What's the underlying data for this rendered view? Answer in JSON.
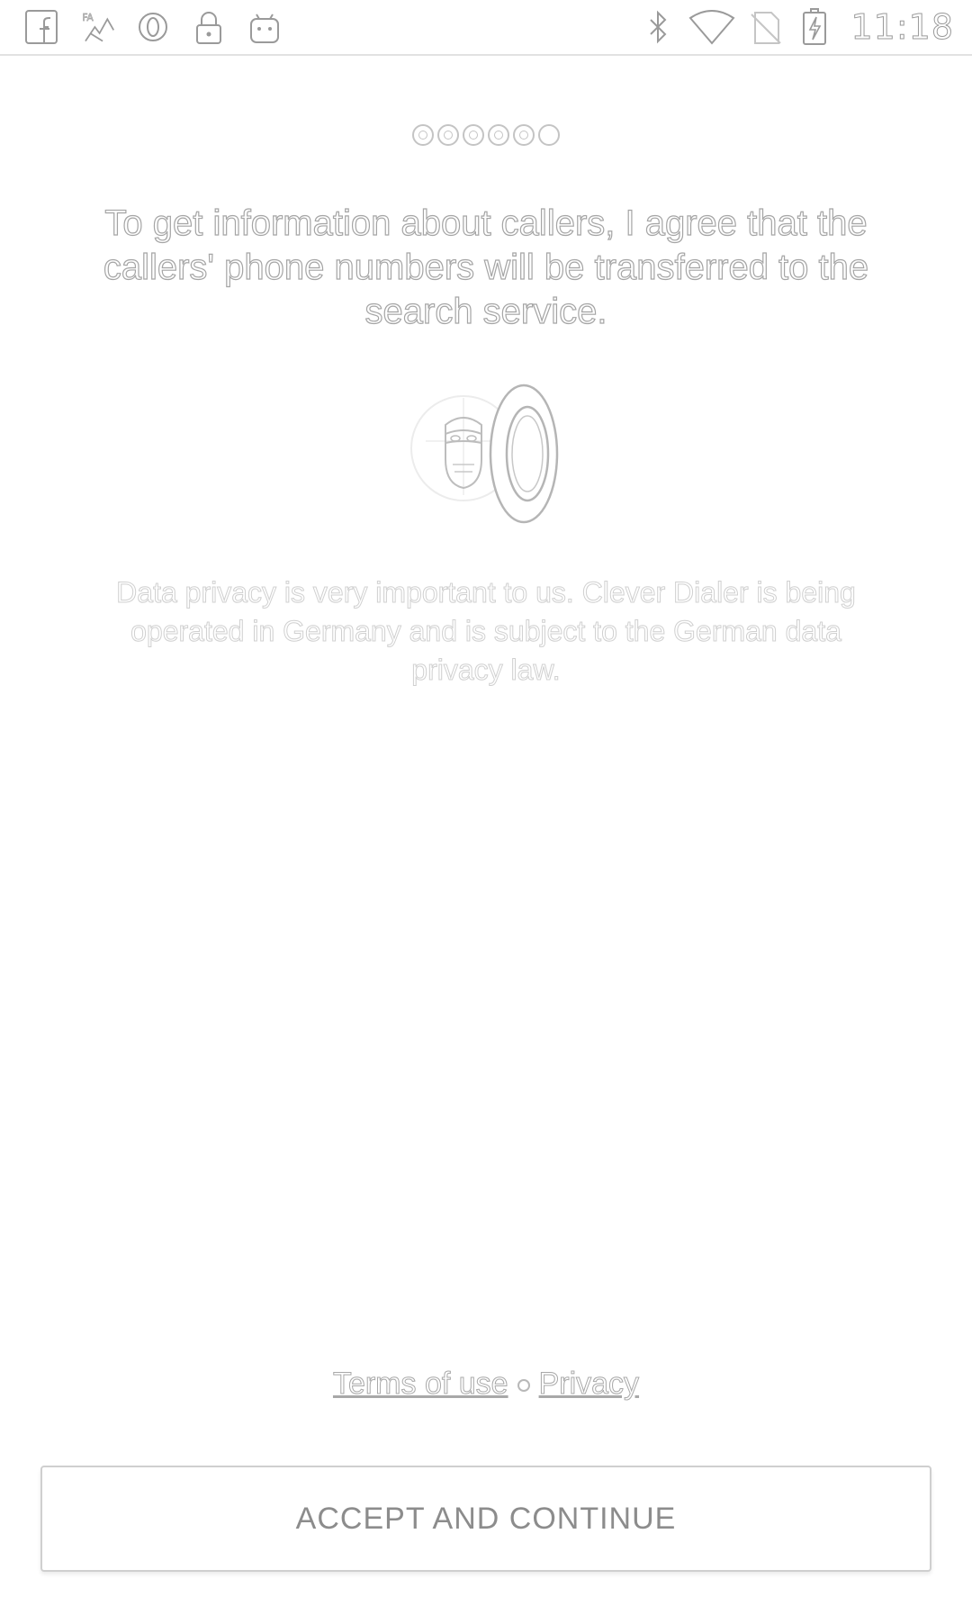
{
  "status_bar": {
    "left_icons": [
      "facebook-icon",
      "fa-map-icon",
      "opera-icon",
      "lock-icon",
      "android-icon"
    ],
    "right_icons": [
      "bluetooth-icon",
      "wifi-icon",
      "no-sim-icon",
      "battery-charging-icon"
    ],
    "time": "11:18"
  },
  "pager": {
    "total": 6,
    "active_index": 5
  },
  "headline": "To get information about callers, I agree that the callers' phone numbers will be transferred to the search service.",
  "illustration": {
    "icon": "privacy-shield-icon"
  },
  "privacy_text": "Data privacy is very important to us. Clever Dialer is being operated in Germany and is subject to the German data privacy law.",
  "links": {
    "terms": "Terms of use",
    "privacy": "Privacy"
  },
  "button": {
    "label": "ACCEPT AND CONTINUE"
  },
  "colors": {
    "outline_text": "#a5a5a5",
    "background": "#ffffff",
    "button_border": "#cfcfcf"
  }
}
